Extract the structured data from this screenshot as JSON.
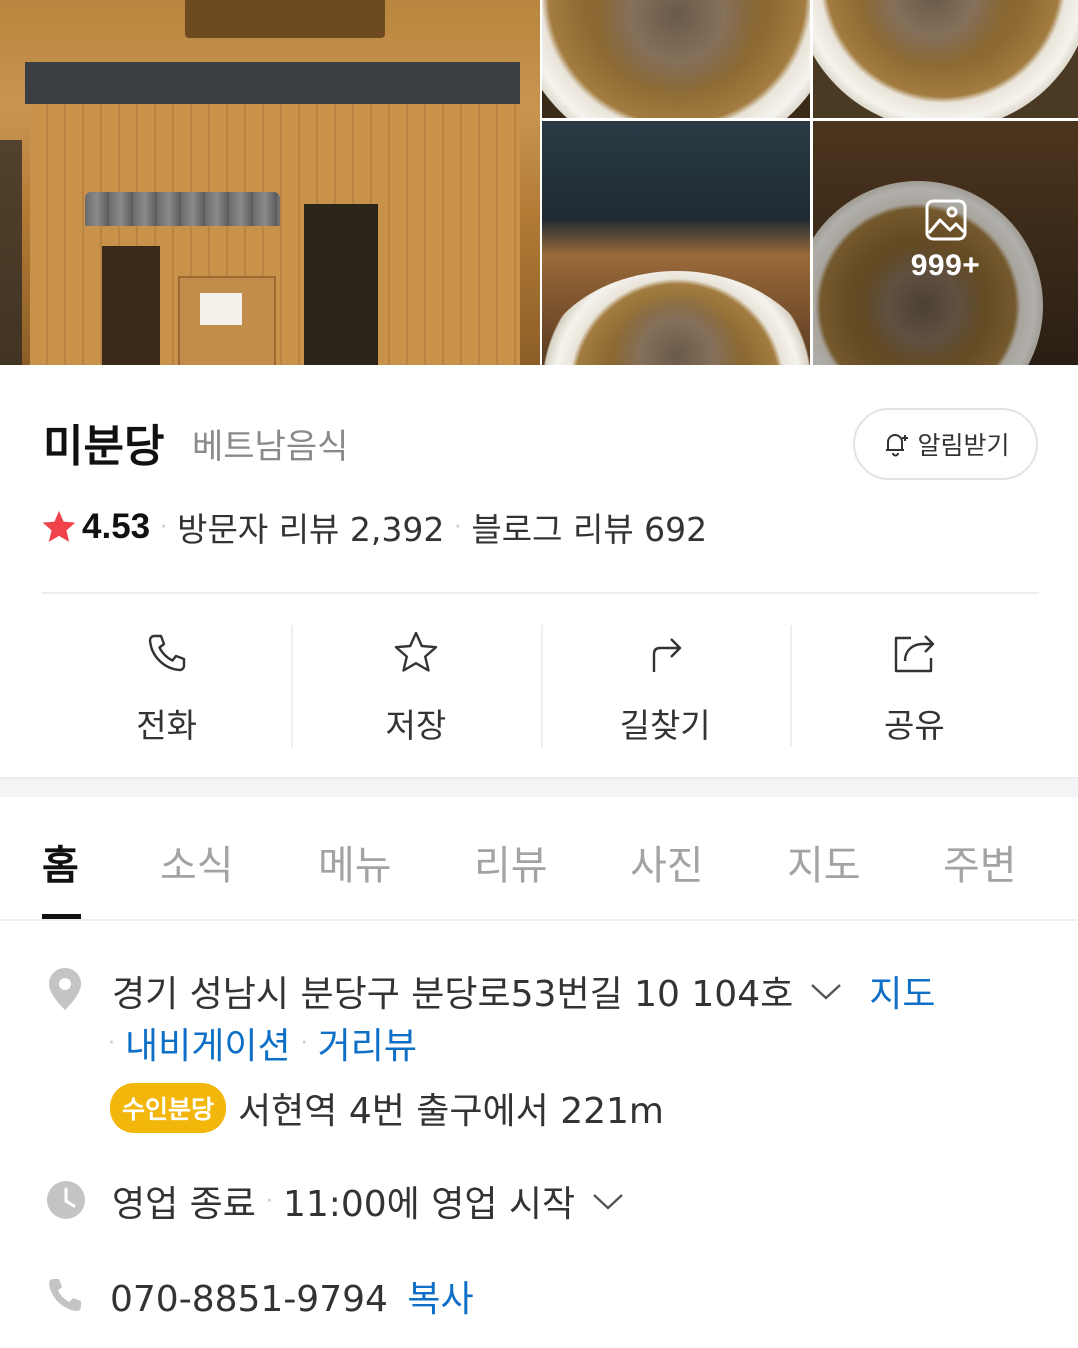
{
  "photos": {
    "more_count": "999+"
  },
  "place": {
    "name": "미분당",
    "category": "베트남음식",
    "alarm_label": "알림받기",
    "rating": "4.53",
    "visitor_reviews": "방문자 리뷰 2,392",
    "blog_reviews": "블로그 리뷰 692",
    "separator": "·"
  },
  "actions": [
    {
      "label": "전화",
      "icon": "phone-icon"
    },
    {
      "label": "저장",
      "icon": "star-outline-icon"
    },
    {
      "label": "길찾기",
      "icon": "directions-icon"
    },
    {
      "label": "공유",
      "icon": "share-icon"
    }
  ],
  "tabs": [
    {
      "label": "홈",
      "active": true
    },
    {
      "label": "소식"
    },
    {
      "label": "메뉴"
    },
    {
      "label": "리뷰"
    },
    {
      "label": "사진"
    },
    {
      "label": "지도"
    },
    {
      "label": "주변"
    }
  ],
  "details": {
    "address": "경기 성남시 분당구 분당로53번길 10 104호",
    "map_link": "지도",
    "navigation_link": "내비게이션",
    "street_view_link": "거리뷰",
    "subway_line": "수인분당",
    "subway_distance": "서현역 4번 출구에서 221m",
    "status": "영업 종료",
    "next_open": "11:00에 영업 시작",
    "phone": "070-8851-9794",
    "copy_label": "복사"
  },
  "colors": {
    "accent_blue": "#0e6fc7",
    "star_red": "#f0424a",
    "subway_yellow": "#f2b70a"
  }
}
